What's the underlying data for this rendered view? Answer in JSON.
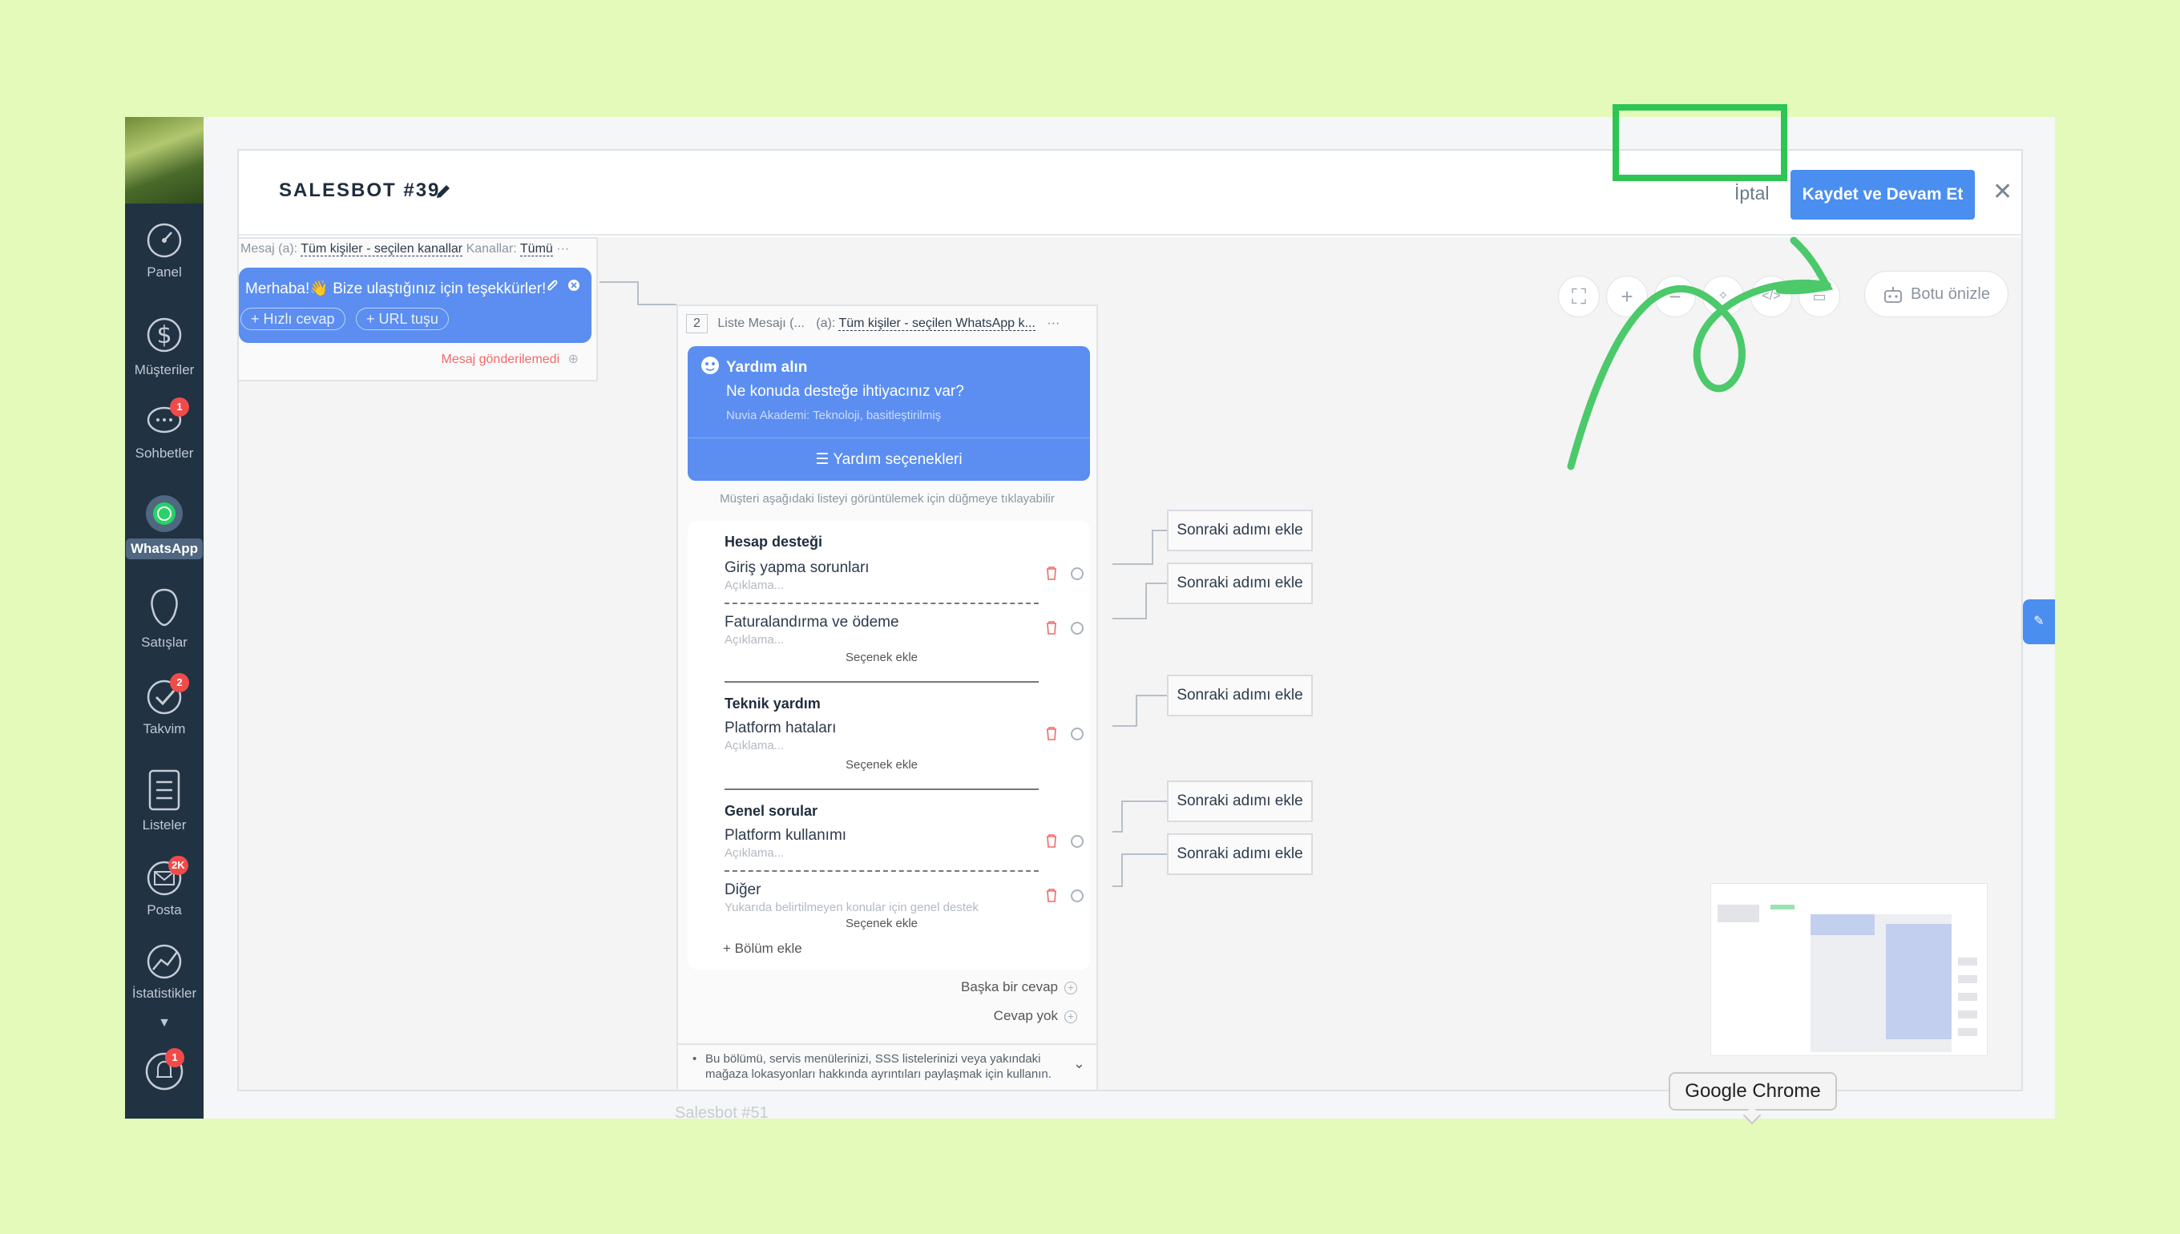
{
  "sidebar": {
    "items": [
      {
        "label": "Panel"
      },
      {
        "label": "Müşteriler"
      },
      {
        "label": "Sohbetler",
        "badge": "1"
      },
      {
        "label": "WhatsApp"
      },
      {
        "label": "Satışlar"
      },
      {
        "label": "Takvim",
        "badge": "2"
      },
      {
        "label": "Listeler"
      },
      {
        "label": "Posta",
        "badge": "2K"
      },
      {
        "label": "İstatistikler"
      }
    ],
    "notifications_badge": "1"
  },
  "background_page": {
    "row_text": "Salesbot #51"
  },
  "modal": {
    "title": "SALESBOT #39",
    "cancel_label": "İptal",
    "save_label": "Kaydet ve Devam Et",
    "close_label": "✕"
  },
  "toolbar": {
    "preview_label": "Botu önizle"
  },
  "card1": {
    "meta_prefix": "Mesaj (a):",
    "meta_audience": "Tüm kişiler - seçilen kanallar",
    "meta_channels_label": "Kanallar:",
    "meta_channels_value": "Tümü",
    "message": "Merhaba!👋 Bize ulaştığınız için teşekkürler!",
    "quick_reply": "+ Hızlı cevap",
    "url_button": "+ URL tuşu",
    "status": "Mesaj gönderilemedi"
  },
  "card2": {
    "step": "2",
    "type": "Liste Mesajı (...",
    "audience_prefix": "(a):",
    "audience": "Tüm kişiler - seçilen WhatsApp k...",
    "title": "Yardım alın",
    "question": "Ne konuda desteğe ihtiyacınız var?",
    "footer_text": "Nuvia Akademi: Teknoloji, basitleştirilmiş",
    "button_label": "Yardım seçenekleri",
    "hint": "Müşteri aşağıdaki listeyi görüntülemek için düğmeye tıklayabilir",
    "sections": [
      {
        "title": "Hesap desteği",
        "options": [
          {
            "label": "Giriş yapma sorunları",
            "desc": "Açıklama..."
          },
          {
            "label": "Faturalandırma ve ödeme",
            "desc": "Açıklama..."
          }
        ]
      },
      {
        "title": "Teknik yardım",
        "options": [
          {
            "label": "Platform hataları",
            "desc": "Açıklama..."
          }
        ]
      },
      {
        "title": "Genel sorular",
        "options": [
          {
            "label": "Platform kullanımı",
            "desc": "Açıklama..."
          },
          {
            "label": "Diğer",
            "desc": "Yukarıda belirtilmeyen konular için genel destek"
          }
        ]
      }
    ],
    "add_option": "Seçenek ekle",
    "add_section": "Bölüm ekle",
    "other_answer": "Başka bir cevap",
    "no_answer": "Cevap yok",
    "info": "Bu bölümü, servis menülerinizi, SSS listelerinizi veya yakındaki mağaza lokasyonları hakkında ayrıntıları paylaşmak için kullanın."
  },
  "next_step_label": "Sonraki adımı ekle",
  "tooltip": "Google Chrome",
  "colors": {
    "accent": "#4a8ef0",
    "highlight": "#2dc653",
    "sidebar": "#213243",
    "background": "#e3fabb"
  }
}
